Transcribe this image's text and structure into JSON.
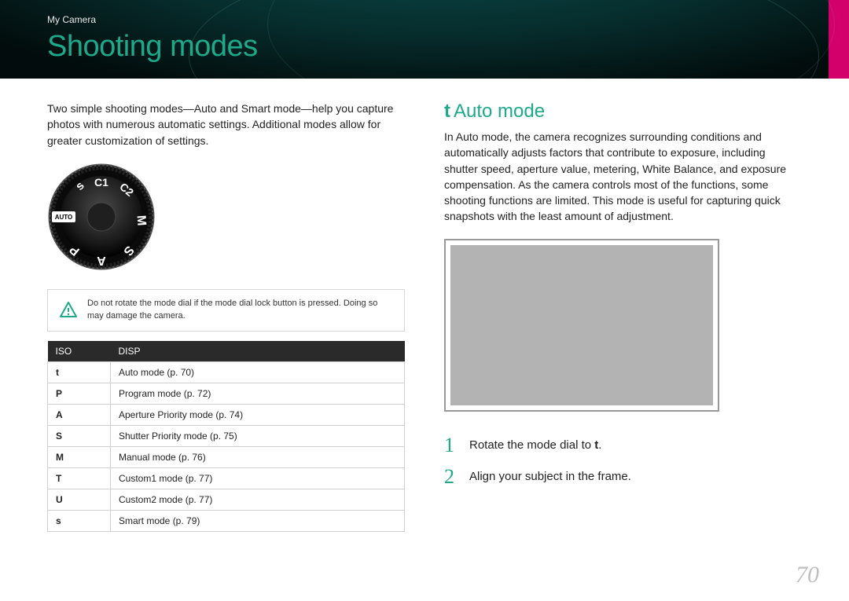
{
  "breadcrumb": "My Camera",
  "page_title": "Shooting modes",
  "intro": "Two simple shooting modes—Auto and Smart mode—help you capture photos with numerous automatic settings. Additional modes allow for greater customization of settings.",
  "dial": {
    "labels": [
      "AUTO",
      "P",
      "A",
      "S",
      "M",
      "C2",
      "C1"
    ],
    "smart_icon": "s"
  },
  "warning": "Do not rotate the mode dial if the mode dial lock button is pressed. Doing so may damage the camera.",
  "table": {
    "head_left": "ISO",
    "head_right": "DISP",
    "rows": [
      {
        "icon": "t",
        "desc": "Auto mode (p. 70)"
      },
      {
        "icon": "P",
        "desc": "Program mode (p. 72)"
      },
      {
        "icon": "A",
        "desc": "Aperture Priority mode (p. 74)"
      },
      {
        "icon": "S",
        "desc": "Shutter Priority mode (p. 75)"
      },
      {
        "icon": "M",
        "desc": "Manual mode (p. 76)"
      },
      {
        "icon": "T",
        "desc": "Custom1 mode (p. 77)"
      },
      {
        "icon": "U",
        "desc": "Custom2 mode (p. 77)"
      },
      {
        "icon": "s",
        "desc": "Smart mode (p. 79)"
      }
    ]
  },
  "right": {
    "heading_prefix": "t",
    "heading": "Auto mode",
    "body": "In Auto mode, the camera recognizes surrounding conditions and automatically adjusts factors that contribute to exposure, including shutter speed, aperture value, metering, White Balance, and exposure compensation. As the camera controls most of the functions, some shooting functions are limited. This mode is useful for capturing quick snapshots with the least amount of adjustment."
  },
  "steps": [
    {
      "n": "1",
      "pre": "Rotate the mode dial to ",
      "bold": "t",
      "post": "."
    },
    {
      "n": "2",
      "pre": "Align your subject in the frame.",
      "bold": "",
      "post": ""
    }
  ],
  "page_number": "70"
}
